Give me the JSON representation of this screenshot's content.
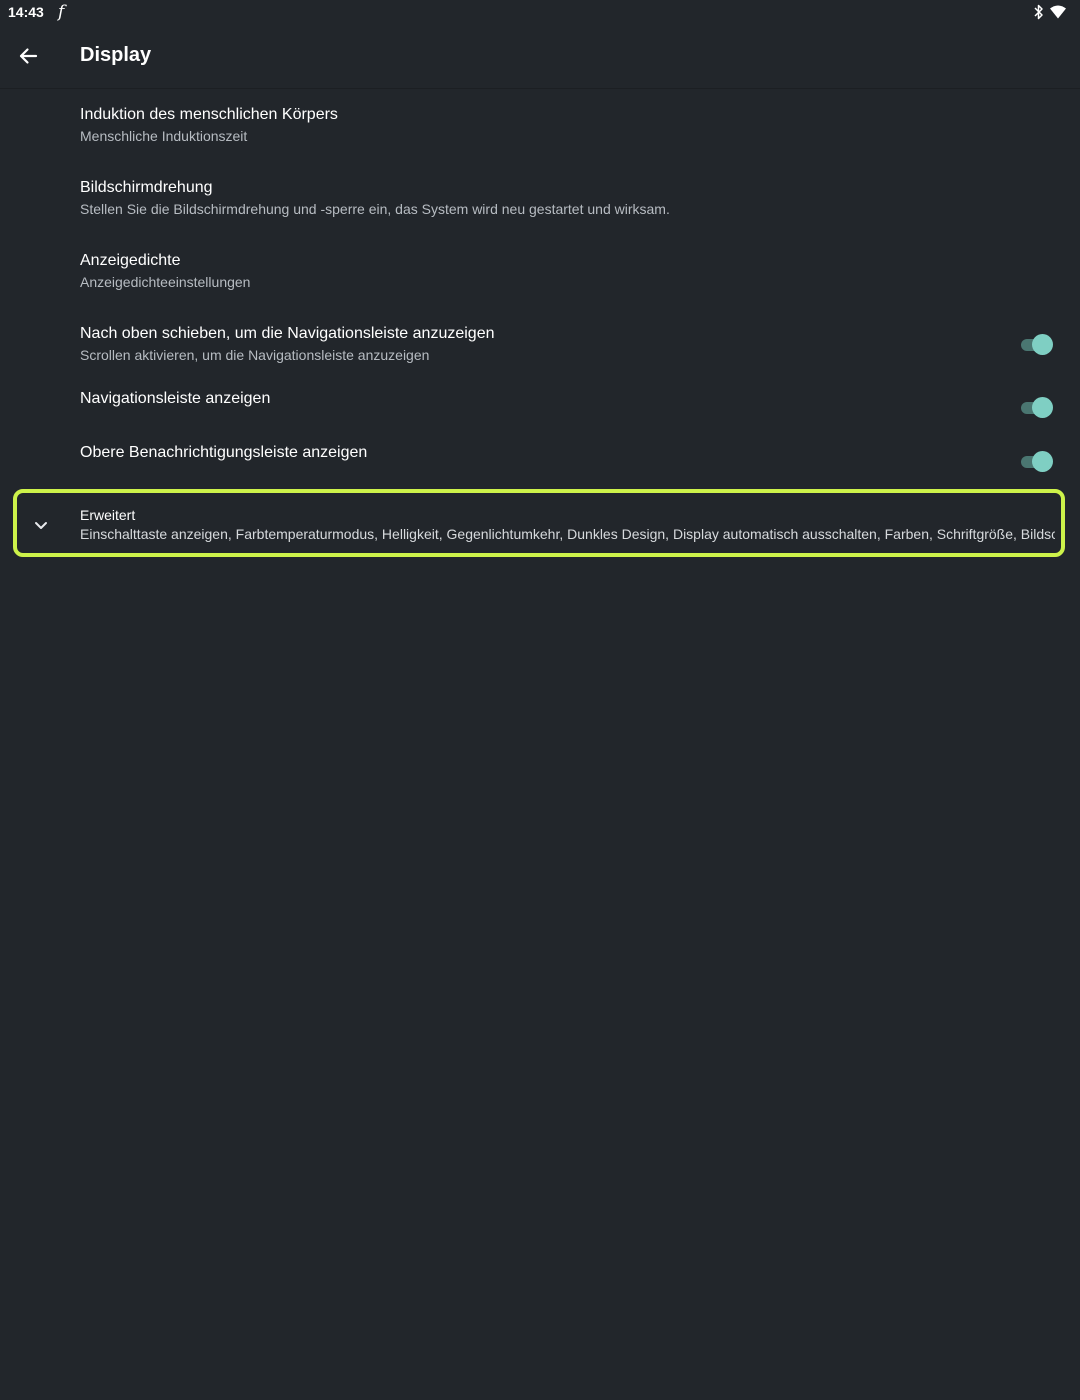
{
  "status_bar": {
    "time": "14:43",
    "app_icon_glyph": "f",
    "icons": [
      "bluetooth-icon",
      "wifi-icon"
    ]
  },
  "app_bar": {
    "title": "Display",
    "back_icon": "arrow-left-icon"
  },
  "preferences": [
    {
      "title": "Induktion des menschlichen Körpers",
      "summary": "Menschliche Induktionszeit"
    },
    {
      "title": "Bildschirmdrehung",
      "summary": "Stellen Sie die Bildschirmdrehung und -sperre ein, das System wird neu gestartet und wirksam."
    },
    {
      "title": "Anzeigedichte",
      "summary": "Anzeigedichteeinstellungen"
    },
    {
      "title": "Nach oben schieben, um die Navigationsleiste anzuzeigen",
      "summary": "Scrollen aktivieren, um die Navigationsleiste anzuzeigen",
      "switch_on": true
    },
    {
      "title": "Navigationsleiste anzeigen",
      "switch_on": true
    },
    {
      "title": "Obere Benachrichtigungsleiste anzeigen",
      "switch_on": true
    }
  ],
  "advanced": {
    "title": "Erweitert",
    "summary": "Einschalttaste anzeigen, Farbtemperaturmodus, Helligkeit, Gegenlichtumkehr, Dunkles Design, Display automatisch ausschalten, Farben, Schriftgröße, Bildschi",
    "icon": "chevron-down-icon",
    "highlight_color": "#cdf24a"
  },
  "colors": {
    "background": "#22262b",
    "switch_thumb": "#7fcfc3",
    "switch_track": "#4a7671"
  }
}
